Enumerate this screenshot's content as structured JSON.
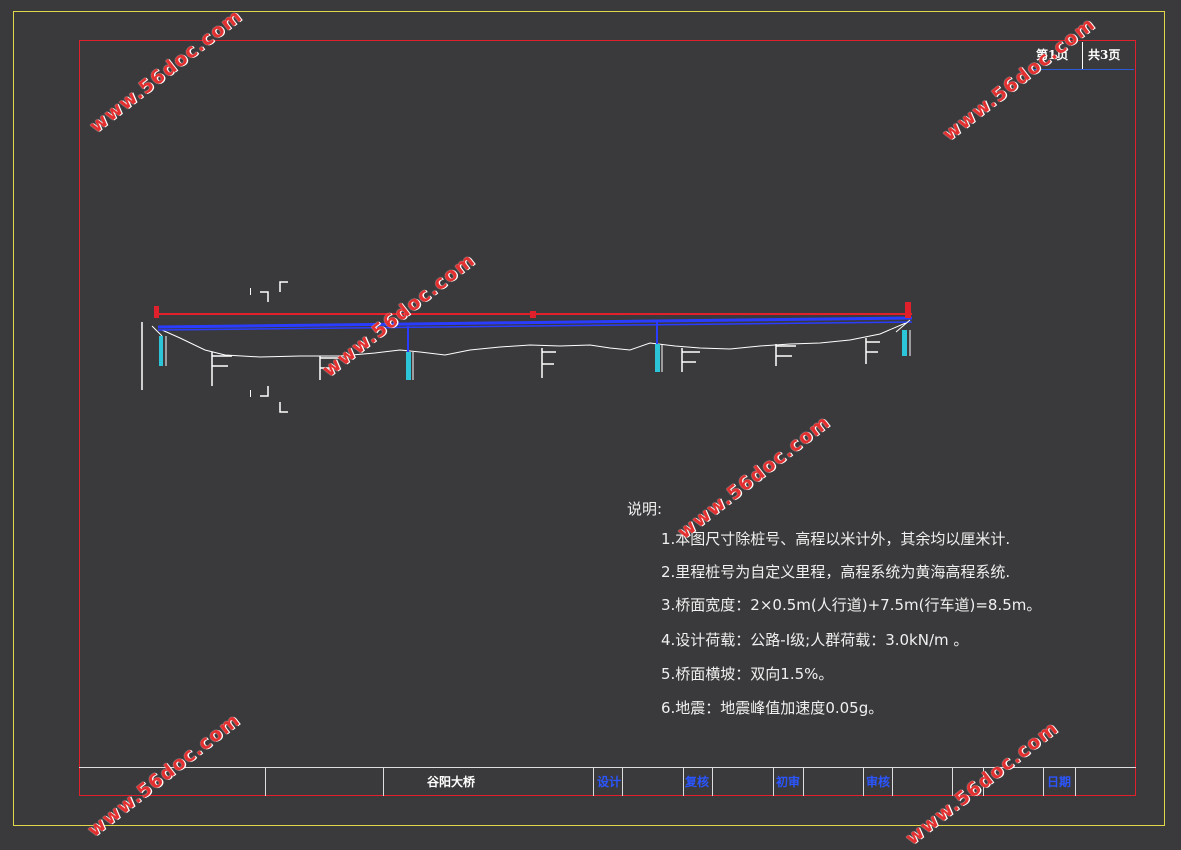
{
  "page_box": {
    "current": "第1页",
    "total": "共3页"
  },
  "title_block": {
    "project": "谷阳大桥",
    "design": "设计",
    "recheck": "复核",
    "review": "初审",
    "approve": "审核",
    "date": "日期"
  },
  "section_marks": {
    "top": "I",
    "bottom": "I"
  },
  "notes": {
    "title": "说明:",
    "items": [
      "1.本图尺寸除桩号、高程以米计外，其余均以厘米计.",
      "2.里程桩号为自定义里程，高程系统为黄海高程系统.",
      "3.桥面宽度：2×0.5m(人行道)+7.5m(行车道)=8.5m。",
      "4.设计荷载：公路-Ⅰ级;人群荷载：3.0kN/m 。",
      "5.桥面横坡：双向1.5%。",
      "6.地震：地震峰值加速度0.05g。"
    ]
  },
  "watermark": "www.56doc.com",
  "colors": {
    "background": "#3a3a3c",
    "outer_frame": "#e0d84a",
    "inner_frame": "#e0202a",
    "deck": "#2a3cff",
    "dimension": "#e0202a",
    "pier": "#2cc4d8",
    "label_blue": "#2a55ff"
  }
}
